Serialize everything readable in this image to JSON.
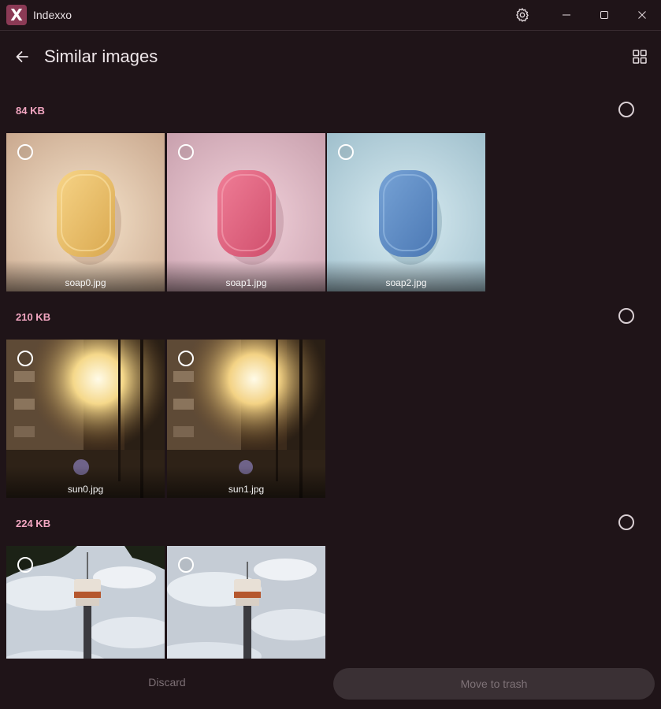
{
  "app": {
    "title": "Indexxo",
    "logo_letter": "X"
  },
  "window_controls": {
    "icons": [
      "gear-icon",
      "minimize-icon",
      "maximize-icon",
      "close-icon"
    ]
  },
  "header": {
    "title": "Similar images",
    "back_icon": "arrow-left-icon",
    "view_icon": "grid-view-icon"
  },
  "groups": [
    {
      "size": "84 KB",
      "files": [
        {
          "name": "soap0.jpg",
          "subject": "yellow soap bar",
          "color": "#f0c46f"
        },
        {
          "name": "soap1.jpg",
          "subject": "pink soap bar",
          "color": "#e46a87"
        },
        {
          "name": "soap2.jpg",
          "subject": "blue soap bar",
          "color": "#5f8ec6"
        }
      ]
    },
    {
      "size": "210 KB",
      "files": [
        {
          "name": "sun0.jpg",
          "subject": "sunset street"
        },
        {
          "name": "sun1.jpg",
          "subject": "sunset street"
        }
      ]
    },
    {
      "size": "224 KB",
      "files": [
        {
          "name": "",
          "subject": "tower against cloudy sky"
        },
        {
          "name": "",
          "subject": "tower against cloudy sky"
        }
      ]
    }
  ],
  "footer": {
    "discard_label": "Discard",
    "trash_label": "Move to trash"
  },
  "colors": {
    "background": "#1f1418",
    "accent": "#f2a6c1",
    "logo": "#8b3a55"
  }
}
